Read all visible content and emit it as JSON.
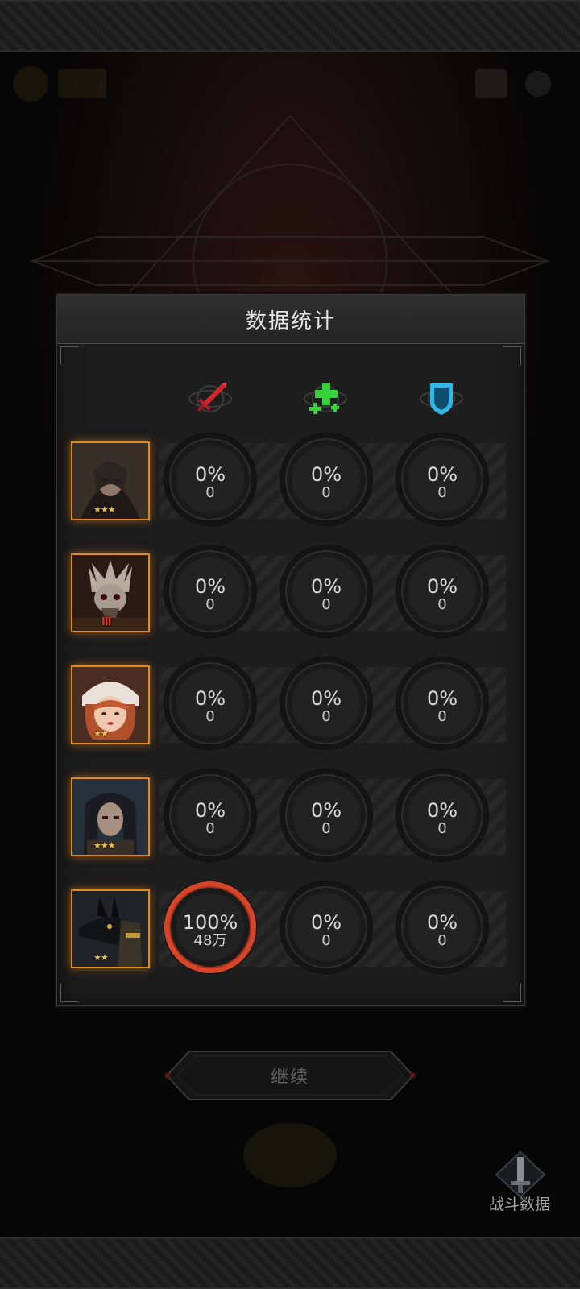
{
  "panel": {
    "title": "数据统计"
  },
  "columns": [
    {
      "icon": "sword-icon",
      "color": "#d4262a"
    },
    {
      "icon": "heal-cross-icon",
      "color": "#36d23a"
    },
    {
      "icon": "shield-icon",
      "color": "#2fb7e8"
    }
  ],
  "heroes": [
    {
      "name": "hero-hooded-archer",
      "rank": "★★★",
      "stats": [
        {
          "pct": "0%",
          "val": "0"
        },
        {
          "pct": "0%",
          "val": "0"
        },
        {
          "pct": "0%",
          "val": "0"
        }
      ]
    },
    {
      "name": "hero-bone-demon",
      "rank": "III",
      "stats": [
        {
          "pct": "0%",
          "val": "0"
        },
        {
          "pct": "0%",
          "val": "0"
        },
        {
          "pct": "0%",
          "val": "0"
        }
      ]
    },
    {
      "name": "hero-red-haired-girl",
      "rank": "★★",
      "stats": [
        {
          "pct": "0%",
          "val": "0"
        },
        {
          "pct": "0%",
          "val": "0"
        },
        {
          "pct": "0%",
          "val": "0"
        }
      ]
    },
    {
      "name": "hero-dark-haired-man",
      "rank": "★★★",
      "stats": [
        {
          "pct": "0%",
          "val": "0"
        },
        {
          "pct": "0%",
          "val": "0"
        },
        {
          "pct": "0%",
          "val": "0"
        }
      ]
    },
    {
      "name": "hero-jackal-warrior",
      "rank": "★★",
      "stats": [
        {
          "pct": "100%",
          "val": "48万"
        },
        {
          "pct": "0%",
          "val": "0"
        },
        {
          "pct": "0%",
          "val": "0"
        }
      ]
    }
  ],
  "continue_button": {
    "label": "继续"
  },
  "battle_data_button": {
    "label": "战斗数据"
  },
  "colors": {
    "accent_active": "#d5452a",
    "portrait_border": "#e08a22"
  }
}
